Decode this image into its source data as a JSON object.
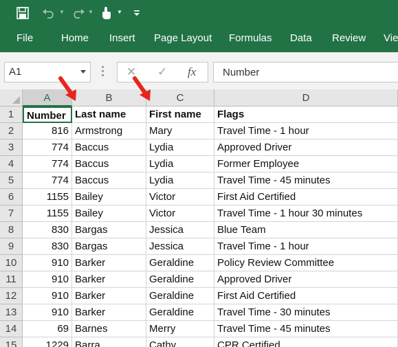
{
  "toolbar": {
    "icons": [
      "save-icon",
      "undo-icon",
      "redo-icon",
      "touch-mode-icon",
      "customize-qat-icon"
    ]
  },
  "ribbon": {
    "tabs": [
      "File",
      "Home",
      "Insert",
      "Page Layout",
      "Formulas",
      "Data",
      "Review",
      "Vie"
    ]
  },
  "formula_bar": {
    "name_box": "A1",
    "cancel_glyph": "✕",
    "enter_glyph": "✓",
    "fx_label": "fx",
    "content": "Number"
  },
  "colors": {
    "excel_green": "#217346",
    "arrow_red": "#e8251d"
  },
  "sheet": {
    "columns": [
      "A",
      "B",
      "C",
      "D"
    ],
    "rows": [
      {
        "n": "1",
        "cells": [
          "Number",
          "Last name",
          "First name",
          "Flags"
        ]
      },
      {
        "n": "2",
        "cells": [
          "816",
          "Armstrong",
          "Mary",
          "Travel Time - 1 hour"
        ]
      },
      {
        "n": "3",
        "cells": [
          "774",
          "Baccus",
          "Lydia",
          "Approved Driver"
        ]
      },
      {
        "n": "4",
        "cells": [
          "774",
          "Baccus",
          "Lydia",
          "Former Employee"
        ]
      },
      {
        "n": "5",
        "cells": [
          "774",
          "Baccus",
          "Lydia",
          "Travel Time - 45 minutes"
        ]
      },
      {
        "n": "6",
        "cells": [
          "1155",
          "Bailey",
          "Victor",
          "First Aid Certified"
        ]
      },
      {
        "n": "7",
        "cells": [
          "1155",
          "Bailey",
          "Victor",
          "Travel Time - 1 hour 30 minutes"
        ]
      },
      {
        "n": "8",
        "cells": [
          "830",
          "Bargas",
          "Jessica",
          "Blue Team"
        ]
      },
      {
        "n": "9",
        "cells": [
          "830",
          "Bargas",
          "Jessica",
          "Travel Time - 1 hour"
        ]
      },
      {
        "n": "10",
        "cells": [
          "910",
          "Barker",
          "Geraldine",
          "Policy Review Committee"
        ]
      },
      {
        "n": "11",
        "cells": [
          "910",
          "Barker",
          "Geraldine",
          "Approved Driver"
        ]
      },
      {
        "n": "12",
        "cells": [
          "910",
          "Barker",
          "Geraldine",
          "First Aid Certified"
        ]
      },
      {
        "n": "13",
        "cells": [
          "910",
          "Barker",
          "Geraldine",
          "Travel Time - 30 minutes"
        ]
      },
      {
        "n": "14",
        "cells": [
          "69",
          "Barnes",
          "Merry",
          "Travel Time - 45 minutes"
        ]
      },
      {
        "n": "15",
        "cells": [
          "1229",
          "Barra",
          "Cathy",
          "CPR Certified"
        ]
      }
    ]
  }
}
